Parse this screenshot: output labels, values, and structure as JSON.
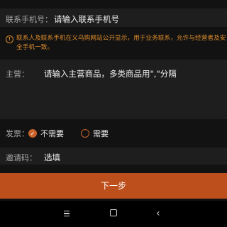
{
  "form": {
    "phone": {
      "label": "联系手机号：",
      "placeholder": "请输入联系手机号"
    },
    "notice": "联系人及联系手机在义乌购网站公开显示，用于业务联系，允许与经营者及安全手机一致。",
    "business": {
      "label": "主营：",
      "placeholder": "请输入主营商品，多类商品用\",\"分隔"
    },
    "invoice": {
      "label": "发票：",
      "options": [
        {
          "label": "不需要",
          "selected": true
        },
        {
          "label": "需要",
          "selected": false
        }
      ]
    },
    "invite": {
      "label": "邀请码：",
      "placeholder": "选填"
    }
  },
  "actions": {
    "next_label": "下一步"
  },
  "colors": {
    "accent": "#bd4f1c",
    "notice": "#d98a2b",
    "background": "#121212"
  },
  "nav_bar": {
    "icons": [
      "menu-icon",
      "home-icon",
      "back-icon"
    ]
  }
}
